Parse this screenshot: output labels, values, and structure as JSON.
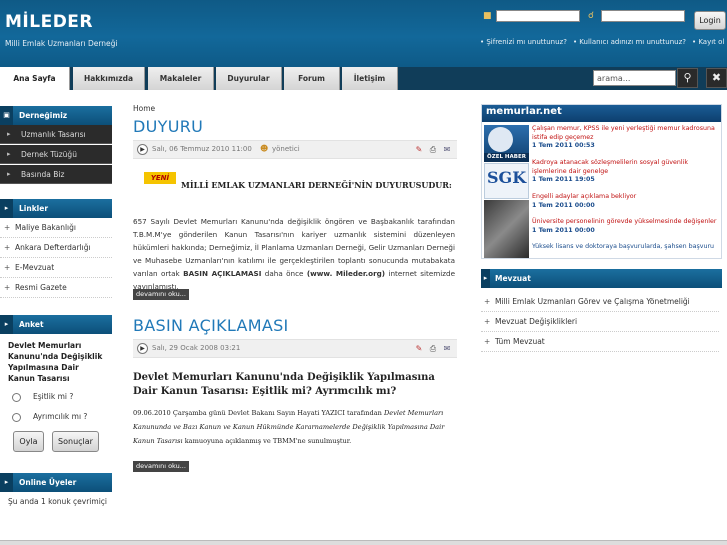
{
  "header": {
    "logo": "MİLEDER",
    "subtitle": "Milli Emlak Uzmanları Derneği",
    "login_button": "Login",
    "links": [
      "• Şifrenizi mı unuttunuz?",
      "• Kullanıcı adınızı mı unuttunuz?",
      "• Kayıt ol"
    ]
  },
  "nav": {
    "tabs": [
      "Ana Sayfa",
      "Hakkımızda",
      "Makaleler",
      "Duyurular",
      "Forum",
      "İletişim"
    ],
    "search_value": "arama..."
  },
  "sidebar": {
    "dernek_title": "Derneğimiz",
    "dernek_items": [
      "Uzmanlık Tasarısı",
      "Dernek Tüzüğü",
      "Basında Biz"
    ],
    "linkler_title": "Linkler",
    "linkler_items": [
      "Maliye Bakanlığı",
      "Ankara Defterdarlığı",
      "E-Mevzuat",
      "Resmi Gazete"
    ],
    "anket_title": "Anket",
    "poll_question": "Devlet Memurları Kanunu'nda Değişiklik Yapılmasına Dair Kanun Tasarısı",
    "poll_options": [
      "Eşitlik mi ?",
      "Ayrımcılık mı ?"
    ],
    "vote_button": "Oyla",
    "results_button": "Sonuçlar",
    "online_title": "Online Üyeler",
    "online_text": "Şu anda 1 konuk çevrimiçi"
  },
  "main": {
    "breadcrumb": "Home",
    "article1": {
      "title": "DUYURU",
      "date": "Salı, 06 Temmuz 2010 11:00",
      "author": "yönetici",
      "badge": "YENİ",
      "heading": "MİLLİ EMLAK UZMANLARI DERNEĞİ'NİN DUYURUSUDUR:",
      "body_part1": "657 Sayılı Devlet Memurları Kanunu'nda değişiklik öngören ve Başbakanlık tarafından T.B.M.M'ye gönderilen Kanun Tasarısı'nın kariyer uzmanlık sistemini düzenleyen hükümleri hakkında; Derneğimiz, İl Planlama Uzmanları Derneği, Gelir Uzmanları Derneği ve Muhasebe Uzmanları'nın katılımı ile gerçekleştirilen toplantı sonucunda mutabakata varılan ortak ",
      "body_bold": "BASIN AÇIKLAMASI",
      "body_part2": " daha önce ",
      "body_bold2": "(www. Mileder.org)",
      "body_part3": " internet sitemizde yayınlamıştı.",
      "more": "devamını oku..."
    },
    "article2": {
      "title": "BASIN AÇIKLAMASI",
      "date": "Salı, 29 Ocak 2008 03:21",
      "heading": "Devlet Memurları Kanunu'nda Değişiklik Yapılmasına Dair Kanun Tasarısı: Eşitlik mi? Ayrımcılık mı?",
      "body_plain1": "09.06.2010 Çarşamba günü Devlet Bakanı Sayın Hayati YAZICI tarafından ",
      "body_italic": "Devlet Memurları Kanununda ve Bazı Kanun ve Kanun Hükmünde Kararnamelerde Değişiklik Yapılmasına Dair Kanun Tasarısı",
      "body_plain2": " kamuoyuna açıklanmış ve TBMM'ne sunulmuştur.",
      "more": "devamını oku..."
    }
  },
  "memurlar": {
    "logo": "memurlar.net",
    "thumb_labels": [
      "ÖZEL HABER",
      "SGK"
    ],
    "items": [
      {
        "title": "Çalışan memur, KPSS ile yeni yerleştiği memur kadrosuna istifa edip geçemez",
        "date": "1 Tem 2011 00:53"
      },
      {
        "title": "Kadroya atanacak sözleşmelilerin sosyal güvenlik işlemlerine dair genelge",
        "date": "1 Tem 2011 19:05"
      },
      {
        "title": "Engelli adaylar açıklama bekliyor",
        "date": "1 Tem 2011 00:00"
      },
      {
        "title": "Üniversite personelinin görevde yükselmesinde değişenler",
        "date": "1 Tem 2011 00:00"
      },
      {
        "title": "Yüksek lisans ve doktoraya başvurularda, şahsen başvuru",
        "date": ""
      }
    ]
  },
  "mevzuat": {
    "title": "Mevzuat",
    "items": [
      "Milli Emlak Uzmanları Görev ve Çalışma Yönetmeliği",
      "Mevzuat Değişiklikleri",
      "Tüm Mevzuat"
    ]
  }
}
